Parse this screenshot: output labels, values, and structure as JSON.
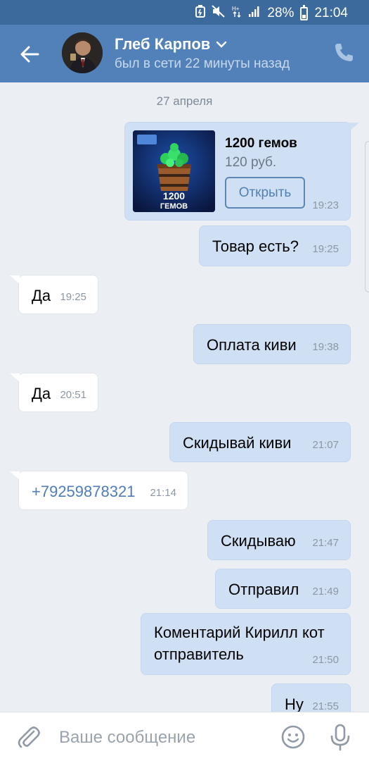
{
  "status_bar": {
    "battery": "28%",
    "time": "21:04",
    "icons": [
      "battery-saver-icon",
      "mute-icon",
      "data-icon",
      "signal-icon",
      "battery-icon"
    ]
  },
  "header": {
    "contact_name": "Глеб Карпов",
    "contact_status": "был в сети 22 минуты назад",
    "icons": [
      "back-arrow-icon",
      "chevron-down-icon",
      "phone-icon"
    ]
  },
  "chat": {
    "date_separator": "27 апреля",
    "product": {
      "image_caption_line1": "1200",
      "image_caption_line2": "ГЕМОВ",
      "title": "1200 гемов",
      "price": "120 руб.",
      "button_label": "Открыть",
      "time": "19:23"
    },
    "messages": [
      {
        "text": "Товар есть?",
        "time": "19:25",
        "dir": "out"
      },
      {
        "text": "Да",
        "time": "19:25",
        "dir": "in"
      },
      {
        "text": "Оплата киви",
        "time": "19:38",
        "dir": "out"
      },
      {
        "text": "Да",
        "time": "20:51",
        "dir": "in"
      },
      {
        "text": "Скидывай киви",
        "time": "21:07",
        "dir": "out"
      },
      {
        "text": "+79259878321",
        "time": "21:14",
        "dir": "in"
      },
      {
        "text": "Скидываю",
        "time": "21:47",
        "dir": "out"
      },
      {
        "text": "Отправил",
        "time": "21:49",
        "dir": "out"
      },
      {
        "text_line1": "Коментарий Кирилл кот",
        "text_line2": "отправитель",
        "time": "21:50",
        "dir": "out"
      },
      {
        "text": "Ну",
        "time": "21:55",
        "dir": "out"
      }
    ]
  },
  "compose": {
    "placeholder": "Ваше сообщение",
    "icons": [
      "attach-icon",
      "emoji-icon",
      "microphone-icon"
    ]
  },
  "colors": {
    "header": "#5181b8",
    "status_bar": "#3d6a9c",
    "outgoing_bubble": "#cfe0f5",
    "incoming_bubble": "#ffffff",
    "background": "#ebeef2",
    "link": "#4e7dba"
  }
}
